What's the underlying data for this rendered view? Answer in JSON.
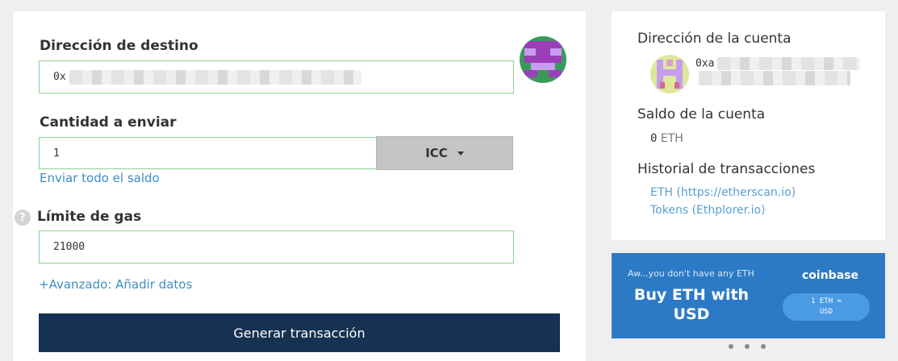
{
  "send_form": {
    "destination_label": "Dirección de destino",
    "destination_value": "0x",
    "amount_label": "Cantidad a enviar",
    "amount_value": "1",
    "unit_label": "ICC",
    "send_all_link": "Enviar todo el saldo",
    "gas_help_icon": "question-icon",
    "gas_help_symbol": "?",
    "gas_label": "Límite de gas",
    "gas_value": "21000",
    "advanced_link": "+Avanzado: Añadir datos",
    "generate_button": "Generar transacción"
  },
  "account_panel": {
    "address_title": "Dirección de la cuenta",
    "address_value": "0xa",
    "balance_title": "Saldo de la cuenta",
    "balance_amount": "0",
    "balance_unit": "ETH",
    "history_title": "Historial de transacciones",
    "history_links": [
      "ETH (https://etherscan.io)",
      "Tokens (Ethplorer.io)"
    ]
  },
  "promo_banner": {
    "small_text": "Aw...you don't have any ETH",
    "headline": "Buy ETH with USD",
    "brand": "coinbase",
    "pill_line1": "1 ETH ≈",
    "pill_line2": "USD"
  },
  "colors": {
    "field_border": "#8fd18f",
    "link": "#3c8ec3",
    "button_bg": "#163151",
    "banner_bg": "#2c7ac5"
  }
}
